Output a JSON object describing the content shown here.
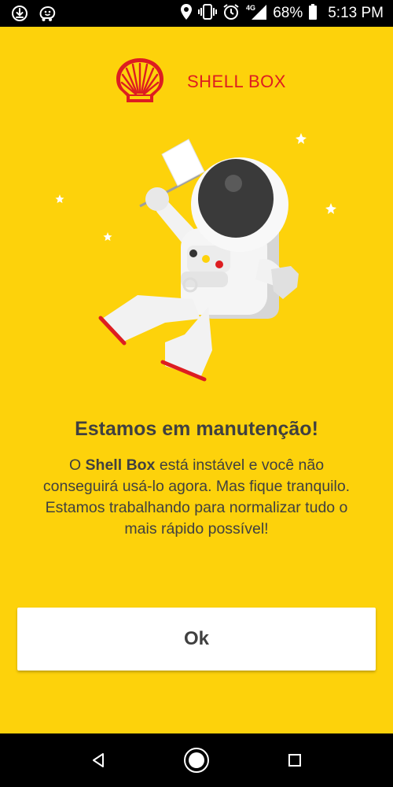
{
  "status_bar": {
    "battery_percent": "68%",
    "time": "5:13 PM",
    "network": "4G",
    "icons": [
      "download-icon",
      "waze-icon",
      "location-icon",
      "vibrate-icon",
      "alarm-icon",
      "signal-icon",
      "battery-icon"
    ]
  },
  "brand": {
    "name": "SHELL BOX",
    "logo": "shell-pecten-logo",
    "color": "#DD1D21"
  },
  "illustration": {
    "subject": "astronaut-with-flag",
    "accent_colors": [
      "#333333",
      "#FDD20B",
      "#DD1D21"
    ]
  },
  "message": {
    "title": "Estamos em manutenção!",
    "body_prefix": "O ",
    "body_bold": "Shell Box",
    "body_suffix": " está instável e você não conseguirá usá-lo agora. Mas fique tranquilo. Estamos trabalhando para normalizar tudo o mais rápido possível!"
  },
  "ok_button": {
    "label": "Ok"
  },
  "nav_bar": {
    "buttons": [
      "back-icon",
      "home-icon",
      "recents-icon"
    ]
  },
  "colors": {
    "background": "#FDD20B",
    "text": "#404040",
    "button_bg": "#FFFFFF"
  }
}
